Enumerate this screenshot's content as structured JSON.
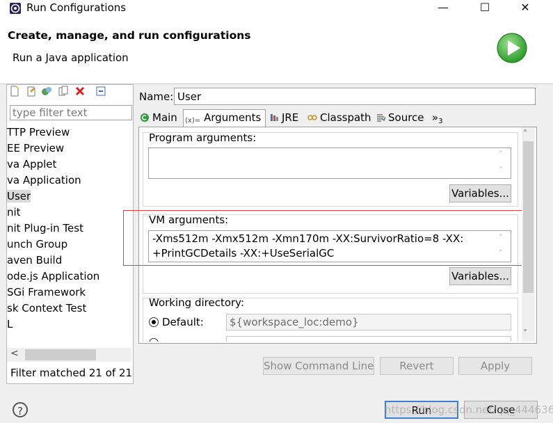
{
  "window": {
    "title": "Run Configurations",
    "minimize": "—",
    "maximize": "☐",
    "close": "✕"
  },
  "header": {
    "title": "Create, manage, and run configurations",
    "subtitle": "Run a Java application"
  },
  "left": {
    "filter_placeholder": "type filter text",
    "items": [
      {
        "label": "TTP Preview",
        "selected": false
      },
      {
        "label": "EE Preview",
        "selected": false
      },
      {
        "label": "va Applet",
        "selected": false
      },
      {
        "label": "va Application",
        "selected": false
      },
      {
        "label": "User",
        "selected": true
      },
      {
        "label": "nit",
        "selected": false
      },
      {
        "label": "nit Plug-in Test",
        "selected": false
      },
      {
        "label": "unch Group",
        "selected": false
      },
      {
        "label": "aven Build",
        "selected": false
      },
      {
        "label": "ode.js Application",
        "selected": false
      },
      {
        "label": "SGi Framework",
        "selected": false
      },
      {
        "label": "sk Context Test",
        "selected": false
      },
      {
        "label": "L",
        "selected": false
      }
    ],
    "scroll_left": "<",
    "status": "Filter matched 21 of 21 i"
  },
  "right": {
    "name_label": "Name:",
    "name_value": "User",
    "tabs": [
      {
        "label": "Main",
        "icon": "main-tab-icon"
      },
      {
        "label": "Arguments",
        "icon": "arguments-tab-icon"
      },
      {
        "label": "JRE",
        "icon": "jre-tab-icon"
      },
      {
        "label": "Classpath",
        "icon": "classpath-tab-icon"
      },
      {
        "label": "Source",
        "icon": "source-tab-icon"
      },
      {
        "label": "»",
        "icon": "more-tabs-icon"
      }
    ],
    "more_tabs_count": "3",
    "active_tab": "Arguments",
    "program_args_label": "Program arguments:",
    "program_args_value": "",
    "variables_label": "Variables...",
    "vm_args_label": "VM arguments:",
    "vm_args_value": "-Xms512m -Xmx512m -Xmn170m -XX:SurvivorRatio=8 -XX:\n+PrintGCDetails -XX:+UseSerialGC",
    "working_dir_label": "Working directory:",
    "default_label": "Default:",
    "default_value": "${workspace_loc:demo}",
    "other_label": "Other:",
    "scroll_up": "˄",
    "scroll_down": "˅"
  },
  "buttons": {
    "show_command_line": "Show Command Line",
    "revert": "Revert",
    "apply": "Apply",
    "run": "Run",
    "close": "Close",
    "help": "?"
  },
  "watermark": "https://blog.csdn.net/qq_44463655",
  "colors": {
    "accent": "#3c7fd6",
    "highlight_box": "#e04040",
    "run_icon": "#3aa935"
  }
}
